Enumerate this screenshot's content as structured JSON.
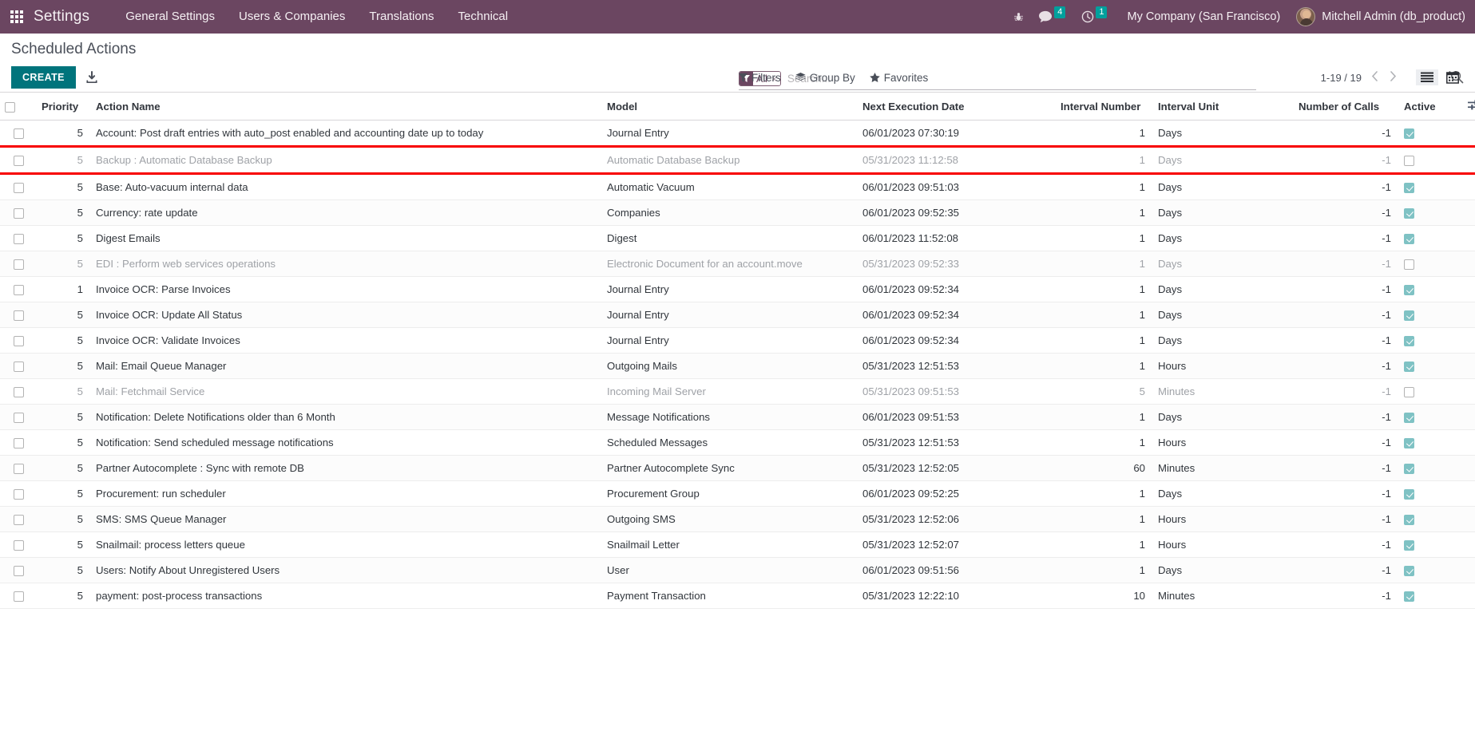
{
  "navbar": {
    "apps_icon": "apps-grid-icon",
    "brand": "Settings",
    "menu": [
      "General Settings",
      "Users & Companies",
      "Translations",
      "Technical"
    ],
    "debug_icon": "bug-icon",
    "messages_icon": "chat-bubble-icon",
    "messages_count": "4",
    "activities_icon": "clock-icon",
    "activities_count": "1",
    "company": "My Company (San Francisco)",
    "user": "Mitchell Admin (db_product)"
  },
  "control_panel": {
    "breadcrumb": "Scheduled Actions",
    "create_label": "CREATE",
    "import_icon": "import-download-icon",
    "search": {
      "facet_icon": "filter-funnel-icon",
      "facet_label": "All",
      "facet_remove": "×",
      "placeholder": "Search...",
      "value": "",
      "magnifier_icon": "search-icon"
    },
    "filters_label": "Filters",
    "groupby_label": "Group By",
    "favorites_label": "Favorites",
    "pager": "1-19 / 19",
    "prev_icon": "chevron-left-icon",
    "next_icon": "chevron-right-icon",
    "view_list_icon": "list-view-icon",
    "view_calendar_icon": "calendar-view-icon"
  },
  "table": {
    "columns": [
      "Priority",
      "Action Name",
      "Model",
      "Next Execution Date",
      "Interval Number",
      "Interval Unit",
      "Number of Calls",
      "Active"
    ],
    "optional_columns_icon": "column-settings-icon",
    "rows": [
      {
        "priority": "5",
        "name": "Account: Post draft entries with auto_post enabled and accounting date up to today",
        "model": "Journal Entry",
        "next_execution": "06/01/2023 07:30:19",
        "interval_number": "1",
        "interval_unit": "Days",
        "number_of_calls": "-1",
        "active": true,
        "highlighted": false
      },
      {
        "priority": "5",
        "name": "Backup : Automatic Database Backup",
        "model": "Automatic Database Backup",
        "next_execution": "05/31/2023 11:12:58",
        "interval_number": "1",
        "interval_unit": "Days",
        "number_of_calls": "-1",
        "active": false,
        "highlighted": true
      },
      {
        "priority": "5",
        "name": "Base: Auto-vacuum internal data",
        "model": "Automatic Vacuum",
        "next_execution": "06/01/2023 09:51:03",
        "interval_number": "1",
        "interval_unit": "Days",
        "number_of_calls": "-1",
        "active": true,
        "highlighted": false
      },
      {
        "priority": "5",
        "name": "Currency: rate update",
        "model": "Companies",
        "next_execution": "06/01/2023 09:52:35",
        "interval_number": "1",
        "interval_unit": "Days",
        "number_of_calls": "-1",
        "active": true,
        "highlighted": false
      },
      {
        "priority": "5",
        "name": "Digest Emails",
        "model": "Digest",
        "next_execution": "06/01/2023 11:52:08",
        "interval_number": "1",
        "interval_unit": "Days",
        "number_of_calls": "-1",
        "active": true,
        "highlighted": false
      },
      {
        "priority": "5",
        "name": "EDI : Perform web services operations",
        "model": "Electronic Document for an account.move",
        "next_execution": "05/31/2023 09:52:33",
        "interval_number": "1",
        "interval_unit": "Days",
        "number_of_calls": "-1",
        "active": false,
        "highlighted": false
      },
      {
        "priority": "1",
        "name": "Invoice OCR: Parse Invoices",
        "model": "Journal Entry",
        "next_execution": "06/01/2023 09:52:34",
        "interval_number": "1",
        "interval_unit": "Days",
        "number_of_calls": "-1",
        "active": true,
        "highlighted": false
      },
      {
        "priority": "5",
        "name": "Invoice OCR: Update All Status",
        "model": "Journal Entry",
        "next_execution": "06/01/2023 09:52:34",
        "interval_number": "1",
        "interval_unit": "Days",
        "number_of_calls": "-1",
        "active": true,
        "highlighted": false
      },
      {
        "priority": "5",
        "name": "Invoice OCR: Validate Invoices",
        "model": "Journal Entry",
        "next_execution": "06/01/2023 09:52:34",
        "interval_number": "1",
        "interval_unit": "Days",
        "number_of_calls": "-1",
        "active": true,
        "highlighted": false
      },
      {
        "priority": "5",
        "name": "Mail: Email Queue Manager",
        "model": "Outgoing Mails",
        "next_execution": "05/31/2023 12:51:53",
        "interval_number": "1",
        "interval_unit": "Hours",
        "number_of_calls": "-1",
        "active": true,
        "highlighted": false
      },
      {
        "priority": "5",
        "name": "Mail: Fetchmail Service",
        "model": "Incoming Mail Server",
        "next_execution": "05/31/2023 09:51:53",
        "interval_number": "5",
        "interval_unit": "Minutes",
        "number_of_calls": "-1",
        "active": false,
        "highlighted": false
      },
      {
        "priority": "5",
        "name": "Notification: Delete Notifications older than 6 Month",
        "model": "Message Notifications",
        "next_execution": "06/01/2023 09:51:53",
        "interval_number": "1",
        "interval_unit": "Days",
        "number_of_calls": "-1",
        "active": true,
        "highlighted": false
      },
      {
        "priority": "5",
        "name": "Notification: Send scheduled message notifications",
        "model": "Scheduled Messages",
        "next_execution": "05/31/2023 12:51:53",
        "interval_number": "1",
        "interval_unit": "Hours",
        "number_of_calls": "-1",
        "active": true,
        "highlighted": false
      },
      {
        "priority": "5",
        "name": "Partner Autocomplete : Sync with remote DB",
        "model": "Partner Autocomplete Sync",
        "next_execution": "05/31/2023 12:52:05",
        "interval_number": "60",
        "interval_unit": "Minutes",
        "number_of_calls": "-1",
        "active": true,
        "highlighted": false
      },
      {
        "priority": "5",
        "name": "Procurement: run scheduler",
        "model": "Procurement Group",
        "next_execution": "06/01/2023 09:52:25",
        "interval_number": "1",
        "interval_unit": "Days",
        "number_of_calls": "-1",
        "active": true,
        "highlighted": false
      },
      {
        "priority": "5",
        "name": "SMS: SMS Queue Manager",
        "model": "Outgoing SMS",
        "next_execution": "05/31/2023 12:52:06",
        "interval_number": "1",
        "interval_unit": "Hours",
        "number_of_calls": "-1",
        "active": true,
        "highlighted": false
      },
      {
        "priority": "5",
        "name": "Snailmail: process letters queue",
        "model": "Snailmail Letter",
        "next_execution": "05/31/2023 12:52:07",
        "interval_number": "1",
        "interval_unit": "Hours",
        "number_of_calls": "-1",
        "active": true,
        "highlighted": false
      },
      {
        "priority": "5",
        "name": "Users: Notify About Unregistered Users",
        "model": "User",
        "next_execution": "06/01/2023 09:51:56",
        "interval_number": "1",
        "interval_unit": "Days",
        "number_of_calls": "-1",
        "active": true,
        "highlighted": false
      },
      {
        "priority": "5",
        "name": "payment: post-process transactions",
        "model": "Payment Transaction",
        "next_execution": "05/31/2023 12:22:10",
        "interval_number": "10",
        "interval_unit": "Minutes",
        "number_of_calls": "-1",
        "active": true,
        "highlighted": false
      }
    ]
  },
  "colors": {
    "navbar_bg": "#6b4661",
    "accent_teal": "#00747c",
    "badge": "#00a09d",
    "highlight_red": "#f80000",
    "checkbox_checked": "#7fc2c4"
  }
}
